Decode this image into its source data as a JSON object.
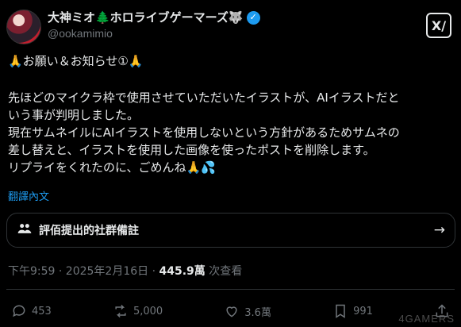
{
  "user": {
    "display_name": "大神ミオ🌲ホロライブゲーマーズ🐺",
    "verified_glyph": "✓",
    "handle": "@ookamimio"
  },
  "x_logo_glyph": "X/",
  "tweet": {
    "first_line": "🙏お願い＆お知らせ①🙏",
    "lines": [
      "先ほどのマイクラ枠で使用させていただいたイラストが、AIイラストだと",
      "いう事が判明しました。",
      "現在サムネイルにAIイラストを使用しないという方針があるためサムネの",
      "差し替えと、イラストを使用した画像を使ったポストを削除します。",
      "リプライをくれたのに、ごめんね🙏💦"
    ],
    "translate": "翻譯內文"
  },
  "community_notes": {
    "label": "評佰提出的社群備註",
    "icon": "community-notes-icon"
  },
  "meta": {
    "time": "下午9:59 · 2025年2月16日 · ",
    "views_count": "445.9萬",
    "views_label": " 次查看"
  },
  "actions": {
    "replies": "453",
    "reposts": "5,000",
    "likes": "3.6萬",
    "bookmarks": "991"
  },
  "watermark": "4GAMERS",
  "colors": {
    "accent": "#1d9bf0",
    "text": "#e7e9ea",
    "muted": "#71767b",
    "border": "#2f3336",
    "background": "#000000"
  }
}
